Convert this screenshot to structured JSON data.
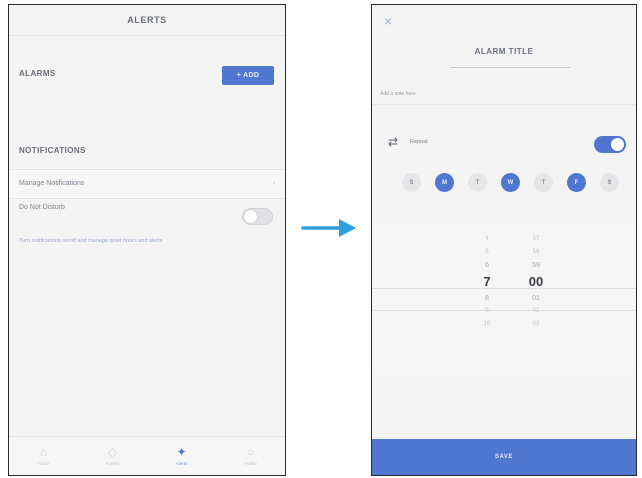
{
  "left_screen": {
    "title": "ALERTS",
    "alarms_label": "ALARMS",
    "add_button_label": "+ ADD",
    "notifications_label": "NOTIFICATIONS",
    "manage_label": "Manage Notifications",
    "manage_chevron": "›",
    "dnd_label": "Do Not Disturb",
    "dnd_toggle_on": false,
    "dnd_description": "Turn notifications on/off and manage quiet hours and alerts",
    "tabs": [
      {
        "icon": "home-icon",
        "glyph": "⌂",
        "label": "Home",
        "active": false
      },
      {
        "icon": "activity-icon",
        "glyph": "◇",
        "label": "Activity",
        "active": false
      },
      {
        "icon": "alerts-icon",
        "glyph": "✦",
        "label": "Alerts",
        "active": true
      },
      {
        "icon": "profile-icon",
        "glyph": "○",
        "label": "Profile",
        "active": false
      }
    ]
  },
  "right_screen": {
    "close_glyph": "×",
    "title": "ALARM TITLE",
    "note_placeholder": "Add a note here",
    "repeat_glyph": "⇄",
    "repeat_label": "Repeat",
    "repeat_toggle_on": true,
    "days": [
      {
        "label": "S",
        "selected": false
      },
      {
        "label": "M",
        "selected": true
      },
      {
        "label": "T",
        "selected": false
      },
      {
        "label": "W",
        "selected": true
      },
      {
        "label": "T",
        "selected": false
      },
      {
        "label": "F",
        "selected": true
      },
      {
        "label": "S",
        "selected": false
      }
    ],
    "hours": [
      "4",
      "5",
      "6",
      "7",
      "8",
      "9",
      "10"
    ],
    "minutes": [
      "57",
      "58",
      "59",
      "00",
      "01",
      "02",
      "03"
    ],
    "selected_index": 3,
    "save_label": "SAVE"
  },
  "colors": {
    "accent": "#4f77cf",
    "arrow": "#2f9fe0"
  }
}
